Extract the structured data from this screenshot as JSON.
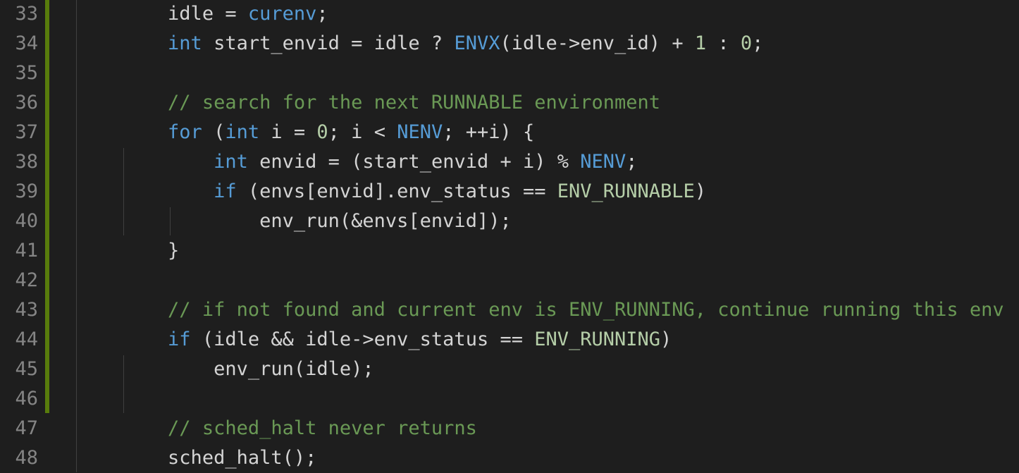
{
  "editor": {
    "lines": [
      {
        "num": "33",
        "tokens": [
          {
            "t": "        "
          },
          {
            "t": "idle = ",
            "c": "id"
          },
          {
            "t": "curenv",
            "c": "mac"
          },
          {
            "t": ";",
            "c": "id"
          }
        ]
      },
      {
        "num": "34",
        "tokens": [
          {
            "t": "        "
          },
          {
            "t": "int",
            "c": "kw"
          },
          {
            "t": " start_envid = idle ? ",
            "c": "id"
          },
          {
            "t": "ENVX",
            "c": "mac"
          },
          {
            "t": "(idle->env_id) + ",
            "c": "id"
          },
          {
            "t": "1",
            "c": "num"
          },
          {
            "t": " : ",
            "c": "id"
          },
          {
            "t": "0",
            "c": "num"
          },
          {
            "t": ";",
            "c": "id"
          }
        ]
      },
      {
        "num": "35",
        "tokens": []
      },
      {
        "num": "36",
        "tokens": [
          {
            "t": "        "
          },
          {
            "t": "// search for the next RUNNABLE environment",
            "c": "cmt"
          }
        ]
      },
      {
        "num": "37",
        "tokens": [
          {
            "t": "        "
          },
          {
            "t": "for",
            "c": "kw"
          },
          {
            "t": " (",
            "c": "id"
          },
          {
            "t": "int",
            "c": "kw"
          },
          {
            "t": " i = ",
            "c": "id"
          },
          {
            "t": "0",
            "c": "num"
          },
          {
            "t": "; i < ",
            "c": "id"
          },
          {
            "t": "NENV",
            "c": "mac"
          },
          {
            "t": "; ++i) {",
            "c": "id"
          }
        ]
      },
      {
        "num": "38",
        "tokens": [
          {
            "t": "            "
          },
          {
            "t": "int",
            "c": "kw"
          },
          {
            "t": " envid = (start_envid + i) % ",
            "c": "id"
          },
          {
            "t": "NENV",
            "c": "mac"
          },
          {
            "t": ";",
            "c": "id"
          }
        ]
      },
      {
        "num": "39",
        "tokens": [
          {
            "t": "            "
          },
          {
            "t": "if",
            "c": "kw"
          },
          {
            "t": " (envs[envid].env_status == ",
            "c": "id"
          },
          {
            "t": "ENV_RUNNABLE",
            "c": "cst"
          },
          {
            "t": ")",
            "c": "id"
          }
        ]
      },
      {
        "num": "40",
        "tokens": [
          {
            "t": "                "
          },
          {
            "t": "env_run(&envs[envid]);",
            "c": "id"
          }
        ]
      },
      {
        "num": "41",
        "tokens": [
          {
            "t": "        "
          },
          {
            "t": "}",
            "c": "id"
          }
        ]
      },
      {
        "num": "42",
        "tokens": []
      },
      {
        "num": "43",
        "tokens": [
          {
            "t": "        "
          },
          {
            "t": "// if not found and current env is ENV_RUNNING, continue running this env",
            "c": "cmt"
          }
        ]
      },
      {
        "num": "44",
        "tokens": [
          {
            "t": "        "
          },
          {
            "t": "if",
            "c": "kw"
          },
          {
            "t": " (idle && idle->env_status == ",
            "c": "id"
          },
          {
            "t": "ENV_RUNNING",
            "c": "cst"
          },
          {
            "t": ")",
            "c": "id"
          }
        ]
      },
      {
        "num": "45",
        "tokens": [
          {
            "t": "            "
          },
          {
            "t": "env_run(idle);",
            "c": "id"
          }
        ]
      },
      {
        "num": "46",
        "tokens": []
      },
      {
        "num": "47",
        "tokens": [
          {
            "t": "        "
          },
          {
            "t": "// sched_halt never returns",
            "c": "cmt"
          }
        ]
      },
      {
        "num": "48",
        "tokens": [
          {
            "t": "        "
          },
          {
            "t": "sched_halt();",
            "c": "id"
          }
        ]
      }
    ]
  },
  "colors": {
    "background": "#1e1e1e",
    "line_number": "#858585",
    "keyword": "#569cd6",
    "comment": "#6a9955",
    "number": "#b5cea8",
    "diff_added": "#587c0c"
  }
}
